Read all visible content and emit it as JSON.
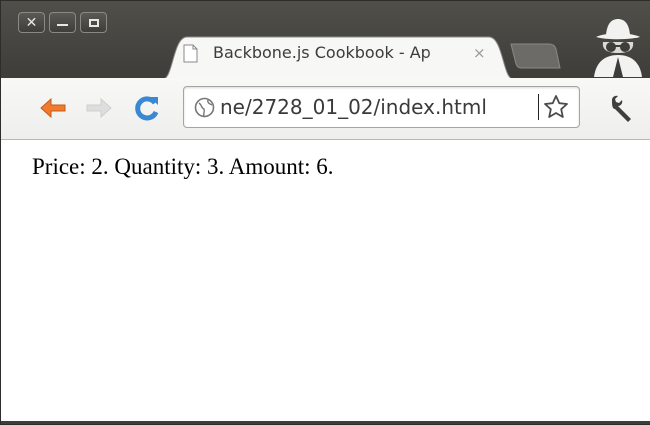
{
  "window": {
    "close_label": "✕"
  },
  "tab": {
    "title": "Backbone.js Cookbook - Ap",
    "close_label": "×"
  },
  "toolbar": {
    "url": "ne/2728_01_02/index.html"
  },
  "content": {
    "text": "Price: 2. Quantity: 3. Amount: 6."
  },
  "icons": {
    "back": "back-arrow-icon",
    "forward": "forward-arrow-icon",
    "reload": "reload-icon",
    "site": "globe-icon",
    "bookmark": "star-icon",
    "menu": "wrench-icon",
    "incognito": "incognito-icon",
    "page": "page-icon"
  },
  "colors": {
    "titlebar": "#45443f",
    "back_arrow": "#f07a2e",
    "reload": "#3a87d4",
    "text": "#000000"
  }
}
